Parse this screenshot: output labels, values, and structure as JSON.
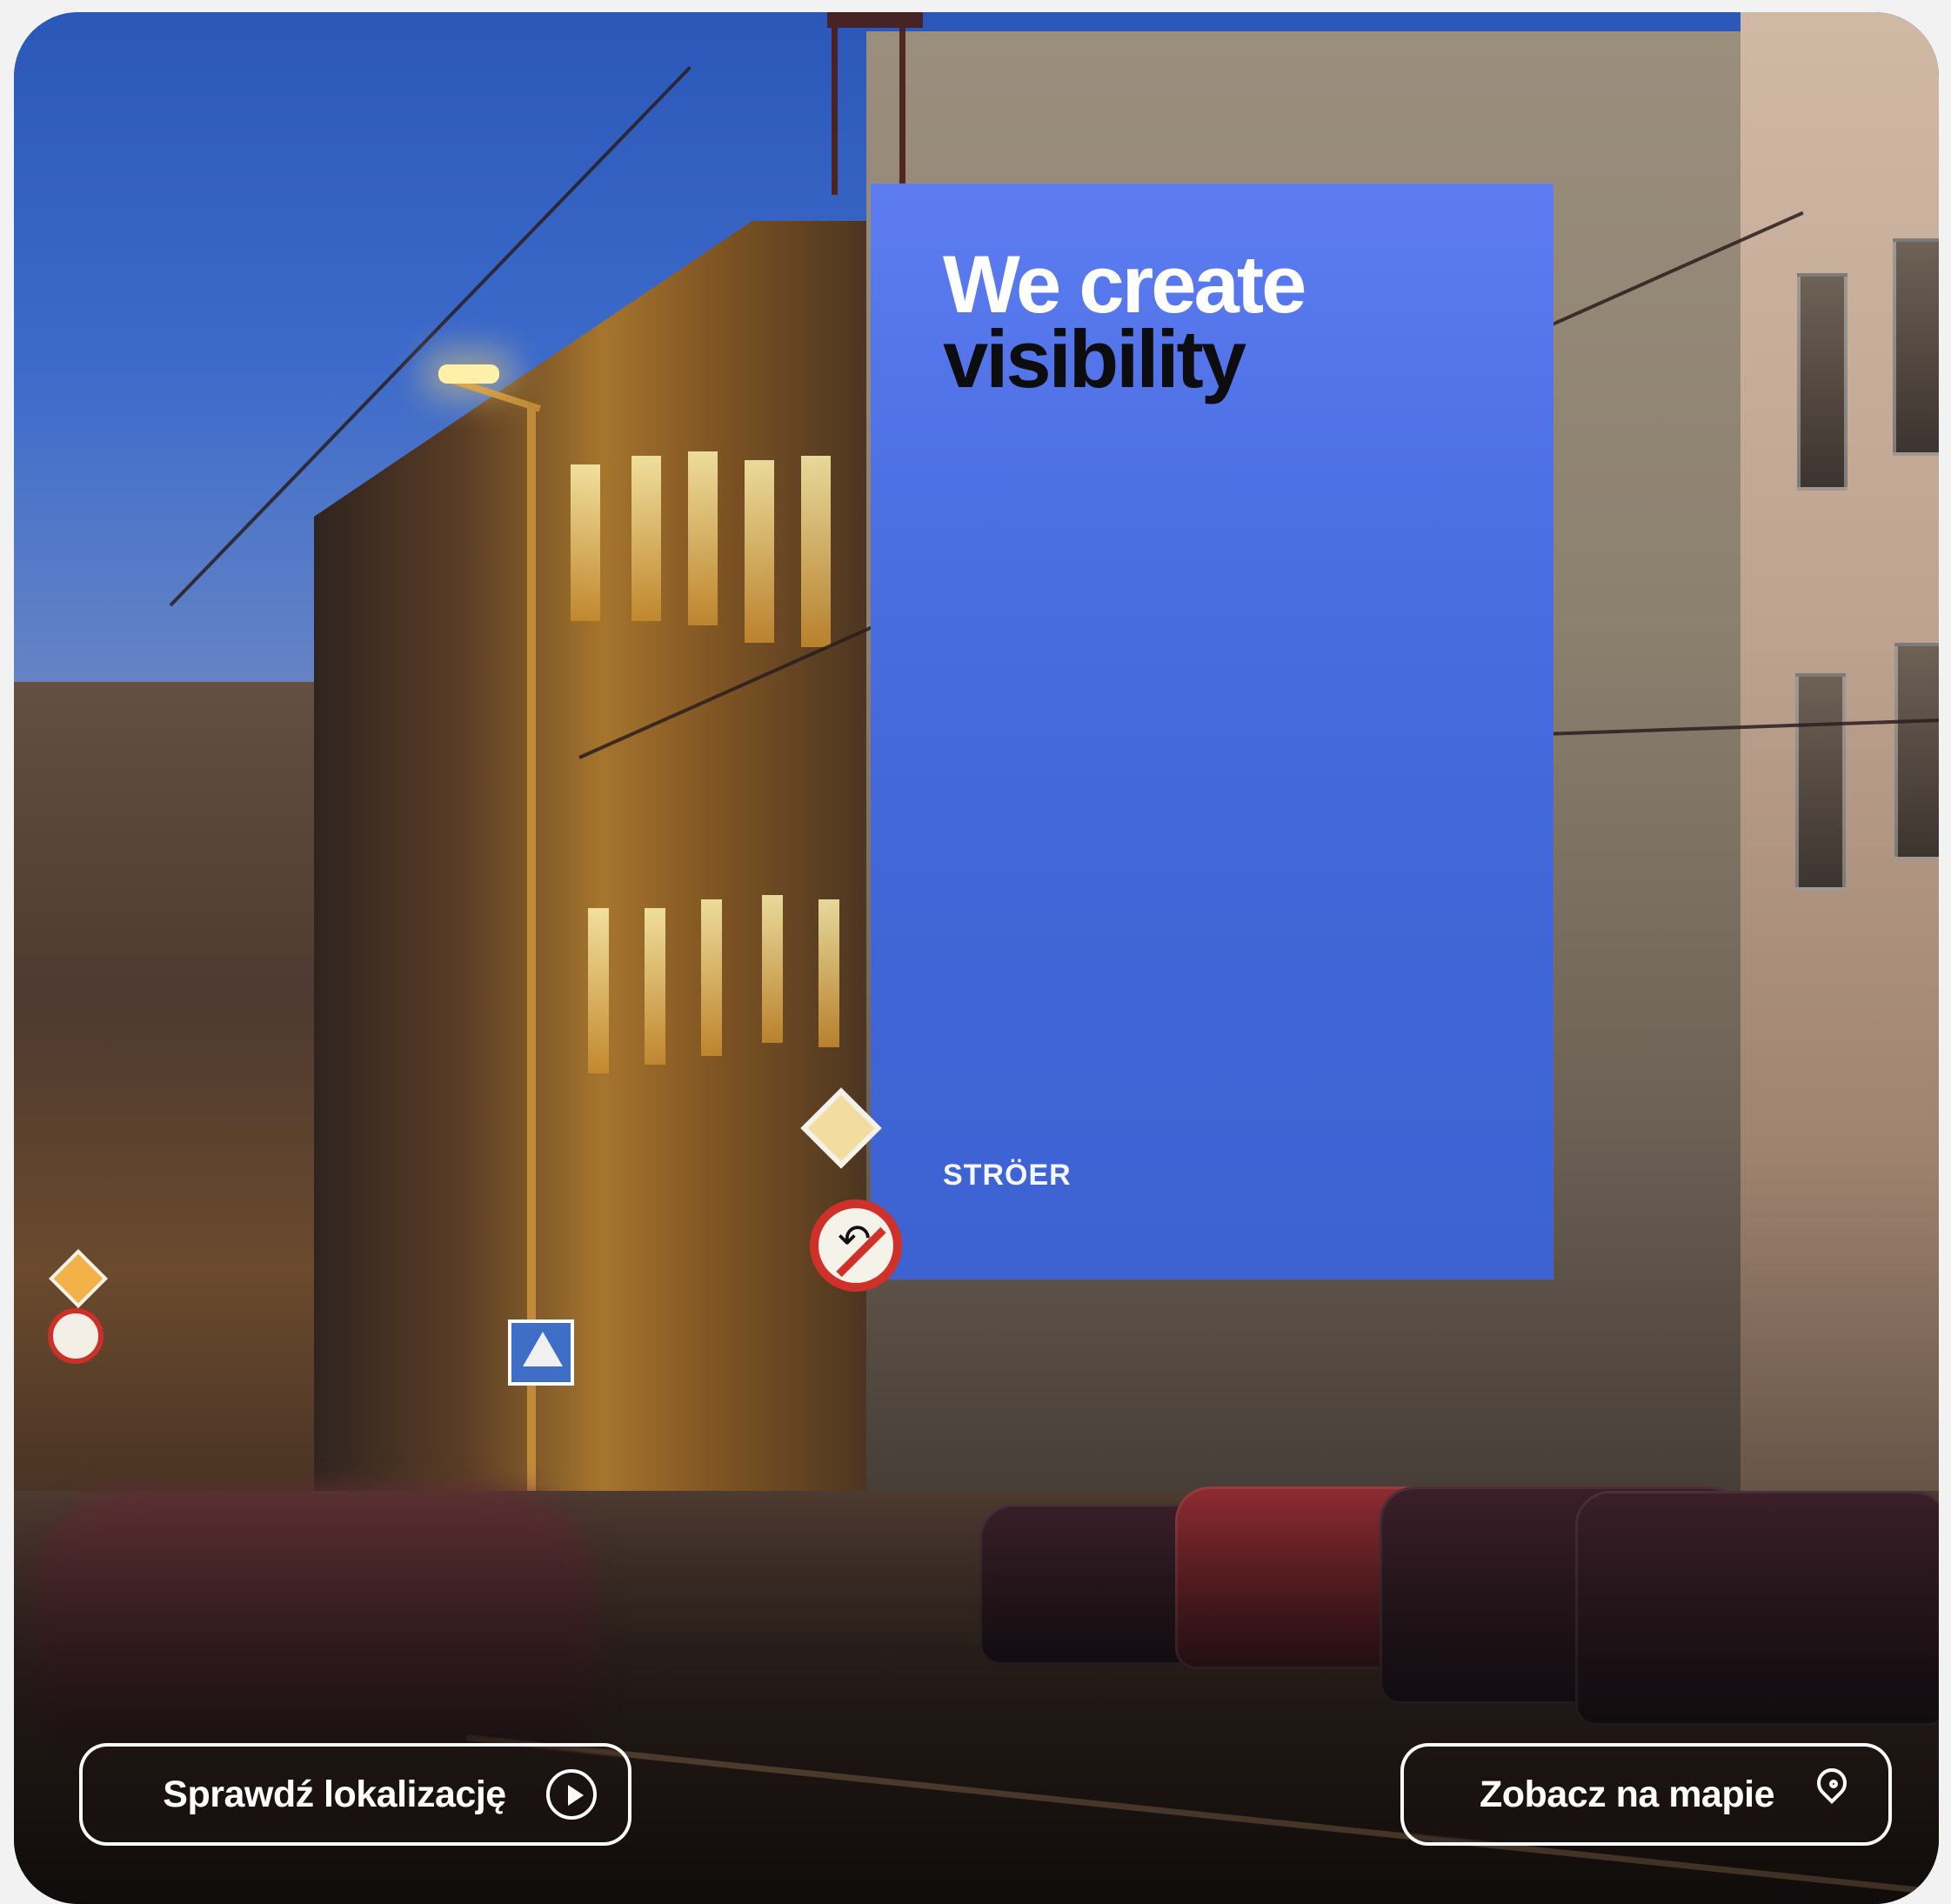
{
  "hero": {
    "billboard": {
      "headline_line_1": "We create",
      "headline_line_2": "visibility",
      "brand": "STRÖER",
      "background_color": "#4a6de2"
    }
  },
  "actions": {
    "primary_button_label": "Sprawdź lokalizację",
    "secondary_button_label": "Zobacz na mapie"
  },
  "icons": {
    "primary_icon": "play-circle-icon",
    "secondary_icon": "location-pin-icon"
  },
  "colors": {
    "button_border": "#ffffff",
    "button_text": "#ffffff",
    "headline_white": "#ffffff",
    "headline_black": "#0d0d10"
  }
}
